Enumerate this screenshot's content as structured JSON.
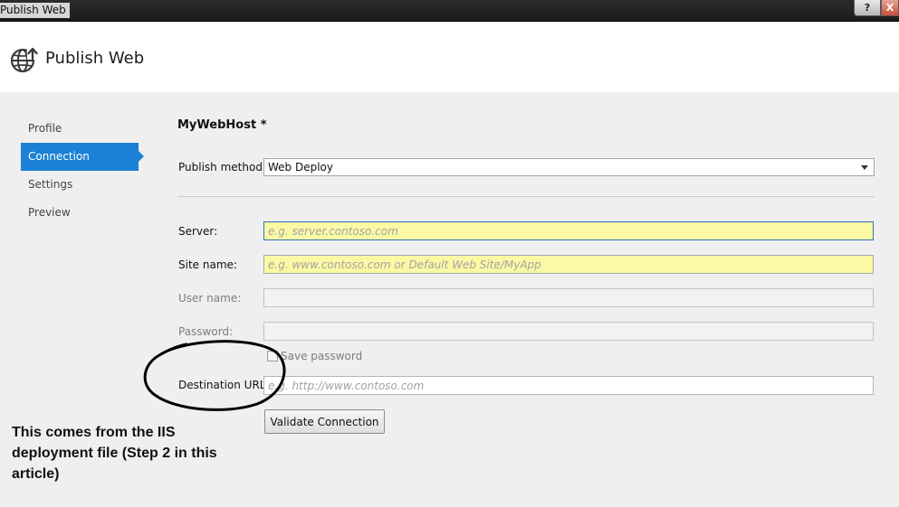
{
  "window": {
    "title": "Publish Web",
    "help_label": "?",
    "close_label": "X"
  },
  "header": {
    "title": "Publish Web",
    "icon": "globe-publish-icon"
  },
  "nav": {
    "items": [
      {
        "label": "Profile",
        "active": false
      },
      {
        "label": "Connection",
        "active": true
      },
      {
        "label": "Settings",
        "active": false
      },
      {
        "label": "Preview",
        "active": false
      }
    ]
  },
  "form": {
    "profile_name": "MyWebHost *",
    "publish_method": {
      "label": "Publish method:",
      "value": "Web Deploy"
    },
    "server": {
      "label": "Server:",
      "value": "",
      "placeholder": "e.g. server.contoso.com"
    },
    "site_name": {
      "label": "Site name:",
      "value": "",
      "placeholder": "e.g. www.contoso.com or Default Web Site/MyApp"
    },
    "user_name": {
      "label": "User name:",
      "value": ""
    },
    "password": {
      "label": "Password:",
      "value": ""
    },
    "save_password": {
      "label": "Save password",
      "checked": false
    },
    "destination_url": {
      "label": "Destination URL:",
      "value": "",
      "placeholder": "e.g. http://www.contoso.com"
    },
    "validate_button": "Validate Connection"
  },
  "annotation": {
    "text": "This comes from the IIS deployment file (Step 2 in this article)"
  },
  "colors": {
    "accent": "#1c81d6",
    "required_field": "#fbf9a4",
    "annotation_ink": "#000000"
  }
}
